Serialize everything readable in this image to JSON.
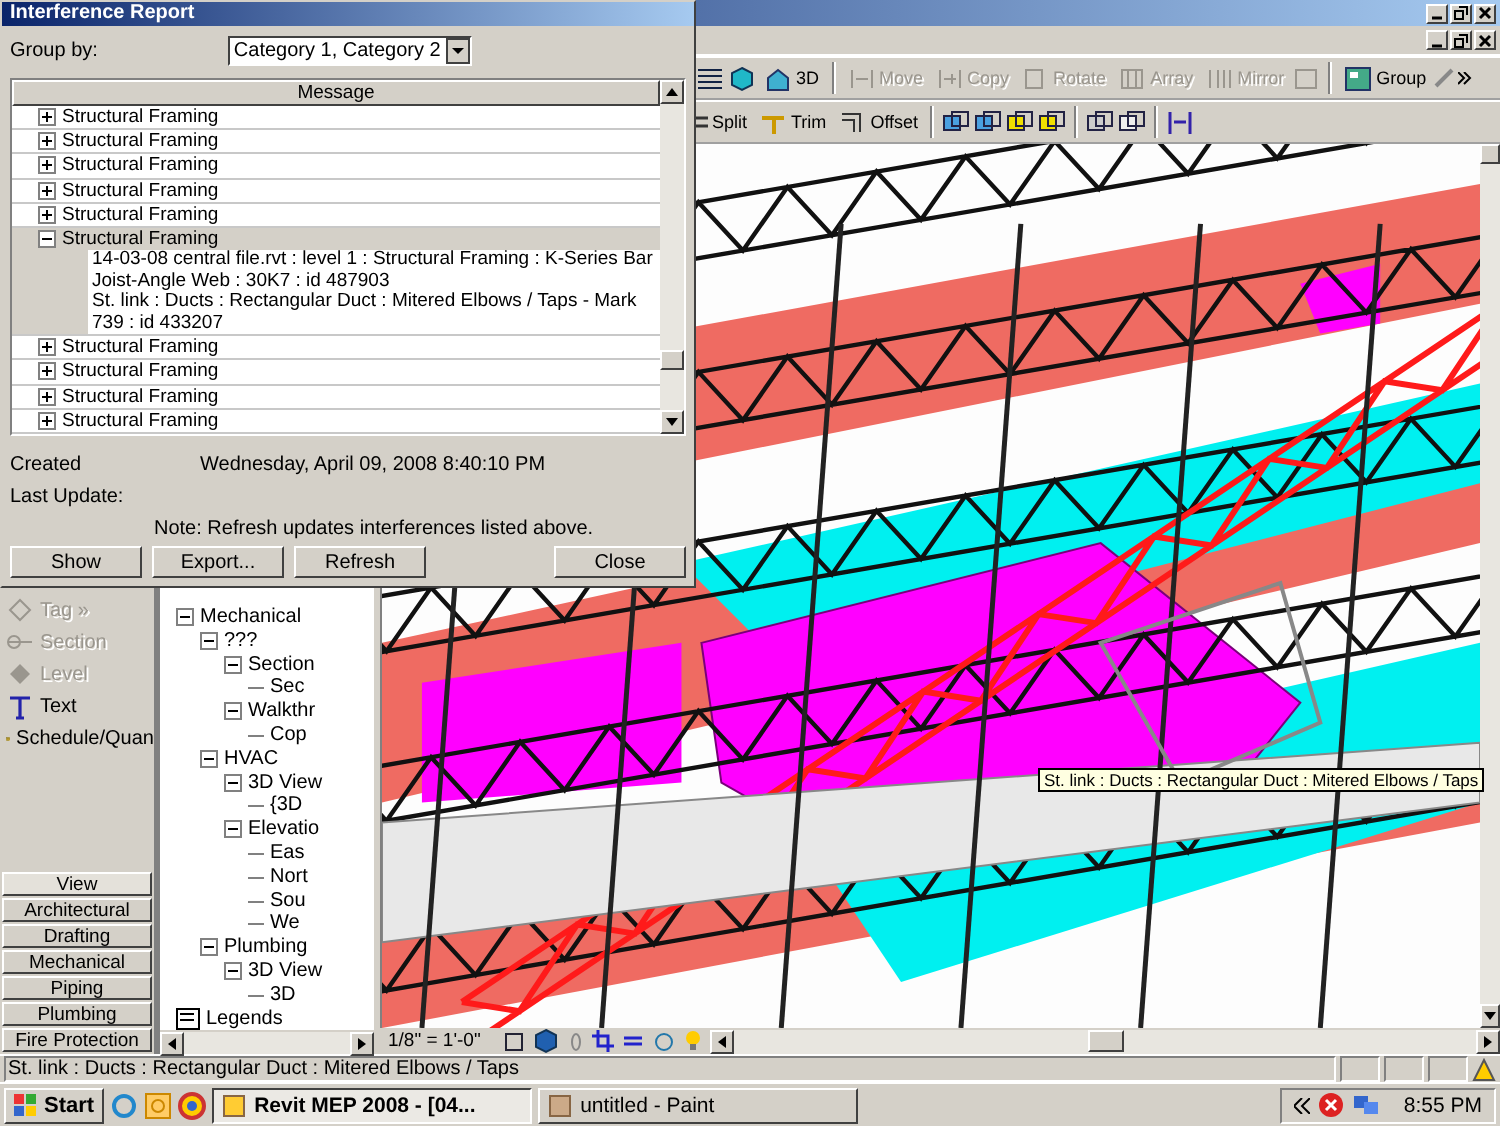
{
  "dialog": {
    "title": "Interference Report",
    "group_by": {
      "label": "Group by:",
      "value": "Category 1, Category 2"
    },
    "table": {
      "column": "Message",
      "rows": [
        {
          "label": "Structural Framing",
          "expanded": false,
          "selected": false
        },
        {
          "label": "Structural Framing",
          "expanded": false,
          "selected": false
        },
        {
          "label": "Structural Framing",
          "expanded": false,
          "selected": false
        },
        {
          "label": "Structural Framing",
          "expanded": false,
          "selected": false
        },
        {
          "label": "Structural Framing",
          "expanded": false,
          "selected": false
        },
        {
          "label": "Structural Framing",
          "expanded": true,
          "selected": true,
          "children": [
            {
              "label": "14-03-08 central file.rvt : level 1 : Structural Framing : K-Series Bar Joist-Angle Web : 30K7 : id 487903"
            },
            {
              "label": "St. link : Ducts : Rectangular Duct : Mitered Elbows / Taps - Mark 739 : id 433207"
            }
          ]
        },
        {
          "label": "Structural Framing",
          "expanded": false,
          "selected": false
        },
        {
          "label": "Structural Framing",
          "expanded": false,
          "selected": false
        },
        {
          "label": "Structural Framing",
          "expanded": false,
          "selected": false
        },
        {
          "label": "Structural Framing",
          "expanded": false,
          "selected": false
        }
      ]
    },
    "created": {
      "label": "Created",
      "value": "Wednesday, April 09, 2008 8:40:10 PM"
    },
    "last_update": {
      "label": "Last Update:"
    },
    "note": "Note: Refresh updates interferences listed above.",
    "buttons": [
      "Show",
      "Export...",
      "Refresh",
      "Close"
    ]
  },
  "toolbar_1": [
    {
      "kind": "view3d",
      "label": "3D",
      "disabled": false
    },
    {
      "kind": "move",
      "label": "Move",
      "disabled": true
    },
    {
      "kind": "copy",
      "label": "Copy",
      "disabled": true
    },
    {
      "kind": "rotate",
      "label": "Rotate",
      "disabled": true
    },
    {
      "kind": "array",
      "label": "Array",
      "disabled": true
    },
    {
      "kind": "mirror",
      "label": "Mirror",
      "disabled": true
    },
    {
      "kind": "group",
      "label": "Group",
      "disabled": false
    }
  ],
  "toolbar_2": [
    {
      "kind": "split",
      "label": "Split"
    },
    {
      "kind": "trim",
      "label": "Trim"
    },
    {
      "kind": "offset",
      "label": "Offset"
    }
  ],
  "design_bar": {
    "items": [
      {
        "kind": "tag",
        "label": "Tag »",
        "disabled": true
      },
      {
        "kind": "section",
        "label": "Section",
        "disabled": true
      },
      {
        "kind": "level",
        "label": "Level",
        "disabled": true
      },
      {
        "kind": "text",
        "label": "Text",
        "disabled": false
      },
      {
        "kind": "schedule",
        "label": "Schedule/Quan",
        "disabled": false
      }
    ],
    "tabs": [
      {
        "label": "View",
        "selected": true
      },
      {
        "label": "Architectural",
        "selected": false
      },
      {
        "label": "Drafting",
        "selected": false
      },
      {
        "label": "Mechanical",
        "selected": false
      },
      {
        "label": "Piping",
        "selected": false
      },
      {
        "label": "Plumbing",
        "selected": false
      },
      {
        "label": "Fire Protection",
        "selected": false
      }
    ]
  },
  "project_browser": {
    "tree": [
      {
        "label": "Mechanical",
        "children": [
          {
            "label": "???",
            "children": [
              {
                "label": "Section",
                "children": [
                  {
                    "label": "Sec"
                  }
                ]
              },
              {
                "label": "Walkthr",
                "children": [
                  {
                    "label": "Cop"
                  }
                ]
              }
            ]
          },
          {
            "label": "HVAC",
            "children": [
              {
                "label": "3D View",
                "children": [
                  {
                    "label": "{3D"
                  }
                ]
              },
              {
                "label": "Elevatio",
                "children": [
                  {
                    "label": "Eas"
                  },
                  {
                    "label": "Nort"
                  },
                  {
                    "label": "Sou"
                  },
                  {
                    "label": "We"
                  }
                ]
              }
            ]
          },
          {
            "label": "Plumbing",
            "children": [
              {
                "label": "3D View",
                "children": [
                  {
                    "label": "3D"
                  }
                ]
              }
            ]
          }
        ]
      },
      {
        "label": "Legends",
        "kind": "legend"
      }
    ]
  },
  "viewport": {
    "tooltip": "St. link : Ducts : Rectangular Duct : Mitered Elbows / Taps",
    "scale": "1/8\" = 1'-0\""
  },
  "status_bar": "St. link : Ducts : Rectangular Duct : Mitered Elbows / Taps",
  "taskbar": {
    "start": "Start",
    "tasks": [
      {
        "label": "Revit MEP 2008 - [04...",
        "selected": true
      },
      {
        "label": "untitled - Paint",
        "selected": false
      }
    ],
    "clock": "8:55 PM"
  }
}
